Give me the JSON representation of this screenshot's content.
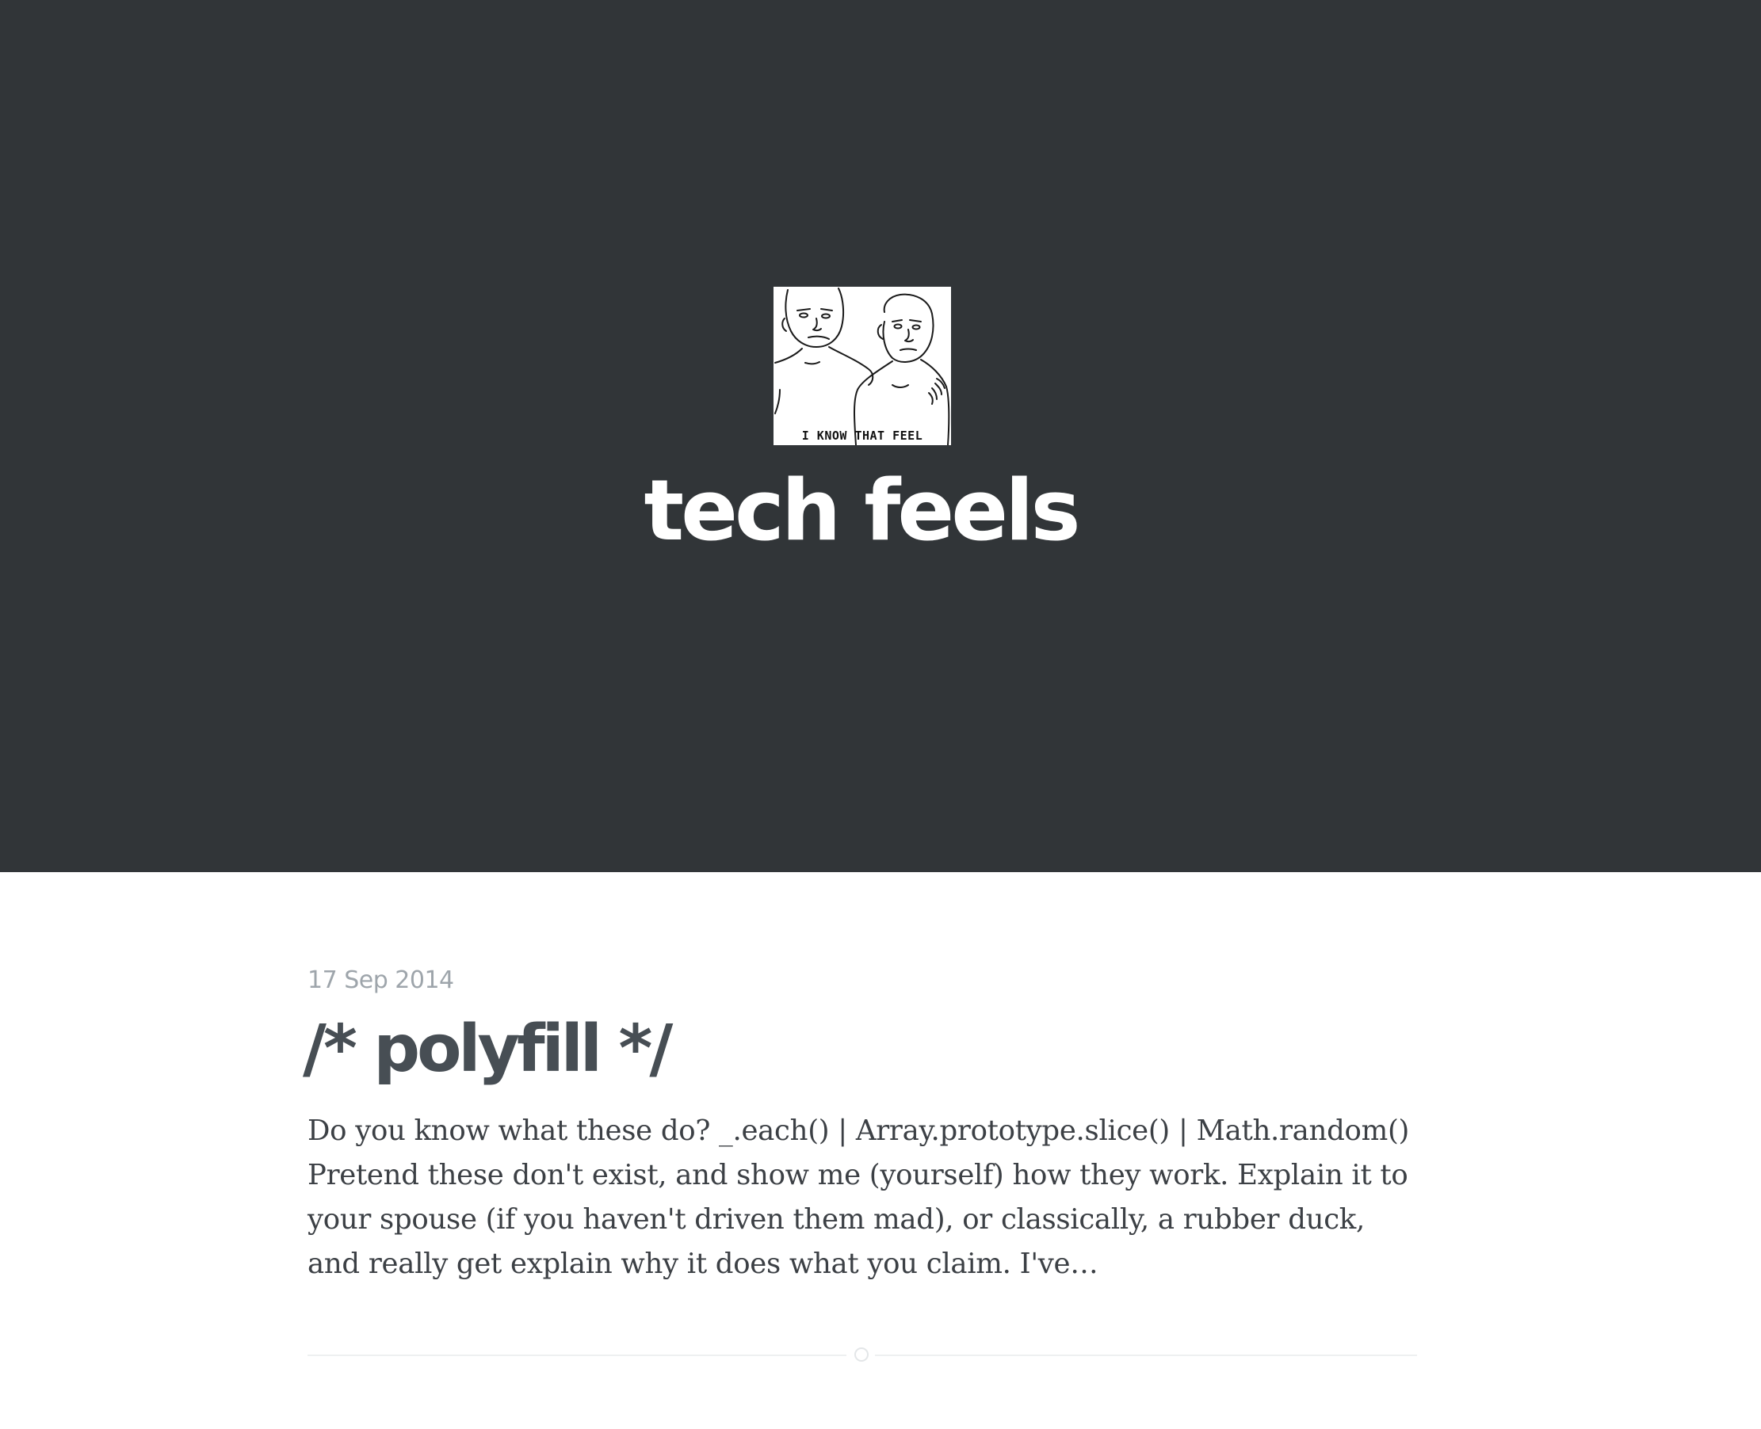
{
  "header": {
    "logo_alt": "I KNOW THAT FEEL",
    "logo_icon": "i-know-that-feel-meme-logo",
    "blog_title": "tech feels",
    "background_color": "#313538"
  },
  "posts": [
    {
      "date": "17 Sep 2014",
      "title": "/* polyfill */",
      "excerpt": "Do you know what these do? _.each() | Array.prototype.slice() | Math.random() Pretend these don't exist, and show me (yourself) how they work. Explain it to your spouse (if you haven't driven them mad), or classically, a rubber duck, and really get explain why it does what you claim. I've…"
    }
  ],
  "colors": {
    "title_color": "#474e54",
    "date_color": "#9ea5ab",
    "body_color": "#3c4045"
  }
}
